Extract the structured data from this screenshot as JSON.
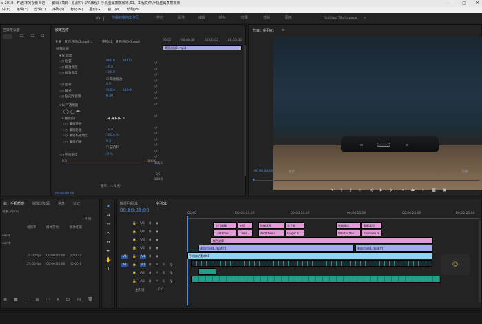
{
  "titlebar": {
    "text": "e 2019 - F:\\吉林的视频日记——剪辑+项目+原素材\\【PR教程】手机金属质感效果\\01、工程文件\\手机金属质感效果",
    "minimize": "—",
    "maximize": "□",
    "close": "✕"
  },
  "menu": [
    "件(F)",
    "编辑(E)",
    "剪辑(C)",
    "序列(S)",
    "标记(M)",
    "图形(G)",
    "窗口(W)",
    "帮助(H)"
  ],
  "workspace": {
    "home_icon": "home-icon",
    "tabs": [
      "仔缘的常用工作区",
      "学习",
      "组件",
      "编辑",
      "颜色",
      "效果",
      "音频",
      "图形",
      "Untitled Workspace"
    ],
    "active": "仔缘的常用工作区",
    "overflow": "»"
  },
  "project_panel": {
    "tab": "自效果设置"
  },
  "effect_controls": {
    "tab": "效果控件",
    "source": "主要 * 黄昆月冠01.mp4 ⌄",
    "sequence": "序列01 * 黄昆月冠01.mp4",
    "clip_label": "黄昆月冠01.mp4",
    "ruler": [
      "00:00",
      "00:00:01",
      "00:00:02",
      "00:00:03"
    ],
    "section_video": "视频效果",
    "motion": "运动",
    "props": [
      {
        "name": "位置",
        "v1": "960.0",
        "v2": "447.0"
      },
      {
        "name": "缩放高度",
        "v1": "40.0",
        "v2": ""
      },
      {
        "name": "缩放宽度",
        "v1": "100.0",
        "v2": ""
      },
      {
        "name": "等比缩放",
        "v1": "",
        "v2": ""
      },
      {
        "name": "旋转",
        "v1": "0.0",
        "v2": ""
      },
      {
        "name": "锚点",
        "v1": "960.0",
        "v2": "540.0"
      },
      {
        "name": "防闪烁滤镜",
        "v1": "0.00",
        "v2": ""
      }
    ],
    "opacity": "不透明度",
    "mask": "蒙版(1)",
    "mask_props": [
      {
        "name": "蒙版路径",
        "v1": ""
      },
      {
        "name": "蒙版羽化",
        "v1": "10.0"
      },
      {
        "name": "蒙版不透明度",
        "v1": "100.0 %"
      },
      {
        "name": "蒙版扩展",
        "v1": "0.0"
      },
      {
        "name": "已反转",
        "v1": ""
      }
    ],
    "opacity_value": "1.0 %",
    "scale_min": "0.0",
    "scale_max": "100.0",
    "graph_top": "100.0",
    "graph_mid": "0.0",
    "graph_bottom": "-100.0",
    "speed_label": "速率：-1.4 /秒",
    "timecode": "00:00:00:00"
  },
  "program": {
    "tab": "节目：序列01",
    "menu_icon": "≡",
    "timecode": "00:00:00:00",
    "fit": "适合",
    "quality": "完整",
    "controls": [
      "marker-icon",
      "in-point-icon",
      "out-point-icon",
      "go-to-in-icon",
      "step-back-icon",
      "play-icon",
      "step-forward-icon",
      "go-to-out-icon",
      "lift-icon",
      "extract-icon",
      "export-frame-icon",
      "comparison-icon"
    ]
  },
  "project_bottom": {
    "tabs": [
      "目：手机质感",
      "媒体浏览器",
      "信息",
      "标记"
    ],
    "file": "效果.prproj",
    "count": "1 个项",
    "headers": [
      "帧速率",
      "媒体开始",
      "媒体结束"
    ],
    "rows": [
      {
        "name": "ear材",
        "fps": "",
        "start": "",
        "end": ""
      },
      {
        "name": "ear材",
        "fps": "",
        "start": "",
        "end": ""
      },
      {
        "name": "",
        "fps": "25.00 fps",
        "start": "00:00:00:00",
        "end": "00:00:0"
      },
      {
        "name": "",
        "fps": "25.00 fps",
        "start": "00:00:00:00",
        "end": "00:00:0"
      }
    ]
  },
  "timeline": {
    "tabs": [
      "黄昆月冠01",
      "序列01"
    ],
    "timecode": "00:00:00:00",
    "ruler": [
      "00:00",
      "00:00:05:00",
      "00:00:10:00",
      "00:00:15:00",
      "00:00:20:00",
      "00:00:25:00"
    ],
    "tracks": [
      "V5",
      "V4",
      "V3",
      "V2",
      "V1",
      "A1",
      "A2",
      "A3",
      "主声道"
    ],
    "master_value": "0.0",
    "v_clips_top": [
      "上门故障",
      "入侵",
      "防御优秀",
      "忘了吧",
      "数据调试",
      "都都看见",
      "Last time",
      "I feel",
      "And then I",
      "Forgot it",
      "What is the",
      "That was m"
    ],
    "clip_color": "颜色遮罩",
    "clip_v2a": "黄昆月冠01.mp4[V]",
    "clip_v2b": "黄昆月冠01.mp4[V]",
    "clip_v1": "手机实拍素材01"
  },
  "colors": {
    "accent": "#4b8fe0",
    "pink": "#e49ad8",
    "lavender": "#a8a8f0",
    "teal": "#1f9f8a"
  }
}
